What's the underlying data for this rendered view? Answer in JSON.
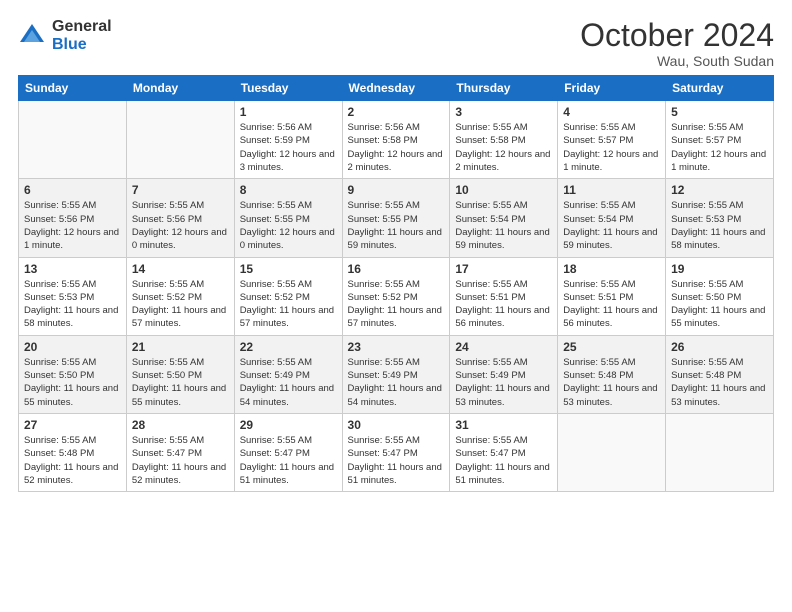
{
  "logo": {
    "general": "General",
    "blue": "Blue"
  },
  "title": "October 2024",
  "subtitle": "Wau, South Sudan",
  "days_of_week": [
    "Sunday",
    "Monday",
    "Tuesday",
    "Wednesday",
    "Thursday",
    "Friday",
    "Saturday"
  ],
  "weeks": [
    [
      {
        "day": "",
        "info": ""
      },
      {
        "day": "",
        "info": ""
      },
      {
        "day": "1",
        "info": "Sunrise: 5:56 AM\nSunset: 5:59 PM\nDaylight: 12 hours and 3 minutes."
      },
      {
        "day": "2",
        "info": "Sunrise: 5:56 AM\nSunset: 5:58 PM\nDaylight: 12 hours and 2 minutes."
      },
      {
        "day": "3",
        "info": "Sunrise: 5:55 AM\nSunset: 5:58 PM\nDaylight: 12 hours and 2 minutes."
      },
      {
        "day": "4",
        "info": "Sunrise: 5:55 AM\nSunset: 5:57 PM\nDaylight: 12 hours and 1 minute."
      },
      {
        "day": "5",
        "info": "Sunrise: 5:55 AM\nSunset: 5:57 PM\nDaylight: 12 hours and 1 minute."
      }
    ],
    [
      {
        "day": "6",
        "info": "Sunrise: 5:55 AM\nSunset: 5:56 PM\nDaylight: 12 hours and 1 minute."
      },
      {
        "day": "7",
        "info": "Sunrise: 5:55 AM\nSunset: 5:56 PM\nDaylight: 12 hours and 0 minutes."
      },
      {
        "day": "8",
        "info": "Sunrise: 5:55 AM\nSunset: 5:55 PM\nDaylight: 12 hours and 0 minutes."
      },
      {
        "day": "9",
        "info": "Sunrise: 5:55 AM\nSunset: 5:55 PM\nDaylight: 11 hours and 59 minutes."
      },
      {
        "day": "10",
        "info": "Sunrise: 5:55 AM\nSunset: 5:54 PM\nDaylight: 11 hours and 59 minutes."
      },
      {
        "day": "11",
        "info": "Sunrise: 5:55 AM\nSunset: 5:54 PM\nDaylight: 11 hours and 59 minutes."
      },
      {
        "day": "12",
        "info": "Sunrise: 5:55 AM\nSunset: 5:53 PM\nDaylight: 11 hours and 58 minutes."
      }
    ],
    [
      {
        "day": "13",
        "info": "Sunrise: 5:55 AM\nSunset: 5:53 PM\nDaylight: 11 hours and 58 minutes."
      },
      {
        "day": "14",
        "info": "Sunrise: 5:55 AM\nSunset: 5:52 PM\nDaylight: 11 hours and 57 minutes."
      },
      {
        "day": "15",
        "info": "Sunrise: 5:55 AM\nSunset: 5:52 PM\nDaylight: 11 hours and 57 minutes."
      },
      {
        "day": "16",
        "info": "Sunrise: 5:55 AM\nSunset: 5:52 PM\nDaylight: 11 hours and 57 minutes."
      },
      {
        "day": "17",
        "info": "Sunrise: 5:55 AM\nSunset: 5:51 PM\nDaylight: 11 hours and 56 minutes."
      },
      {
        "day": "18",
        "info": "Sunrise: 5:55 AM\nSunset: 5:51 PM\nDaylight: 11 hours and 56 minutes."
      },
      {
        "day": "19",
        "info": "Sunrise: 5:55 AM\nSunset: 5:50 PM\nDaylight: 11 hours and 55 minutes."
      }
    ],
    [
      {
        "day": "20",
        "info": "Sunrise: 5:55 AM\nSunset: 5:50 PM\nDaylight: 11 hours and 55 minutes."
      },
      {
        "day": "21",
        "info": "Sunrise: 5:55 AM\nSunset: 5:50 PM\nDaylight: 11 hours and 55 minutes."
      },
      {
        "day": "22",
        "info": "Sunrise: 5:55 AM\nSunset: 5:49 PM\nDaylight: 11 hours and 54 minutes."
      },
      {
        "day": "23",
        "info": "Sunrise: 5:55 AM\nSunset: 5:49 PM\nDaylight: 11 hours and 54 minutes."
      },
      {
        "day": "24",
        "info": "Sunrise: 5:55 AM\nSunset: 5:49 PM\nDaylight: 11 hours and 53 minutes."
      },
      {
        "day": "25",
        "info": "Sunrise: 5:55 AM\nSunset: 5:48 PM\nDaylight: 11 hours and 53 minutes."
      },
      {
        "day": "26",
        "info": "Sunrise: 5:55 AM\nSunset: 5:48 PM\nDaylight: 11 hours and 53 minutes."
      }
    ],
    [
      {
        "day": "27",
        "info": "Sunrise: 5:55 AM\nSunset: 5:48 PM\nDaylight: 11 hours and 52 minutes."
      },
      {
        "day": "28",
        "info": "Sunrise: 5:55 AM\nSunset: 5:47 PM\nDaylight: 11 hours and 52 minutes."
      },
      {
        "day": "29",
        "info": "Sunrise: 5:55 AM\nSunset: 5:47 PM\nDaylight: 11 hours and 51 minutes."
      },
      {
        "day": "30",
        "info": "Sunrise: 5:55 AM\nSunset: 5:47 PM\nDaylight: 11 hours and 51 minutes."
      },
      {
        "day": "31",
        "info": "Sunrise: 5:55 AM\nSunset: 5:47 PM\nDaylight: 11 hours and 51 minutes."
      },
      {
        "day": "",
        "info": ""
      },
      {
        "day": "",
        "info": ""
      }
    ]
  ]
}
